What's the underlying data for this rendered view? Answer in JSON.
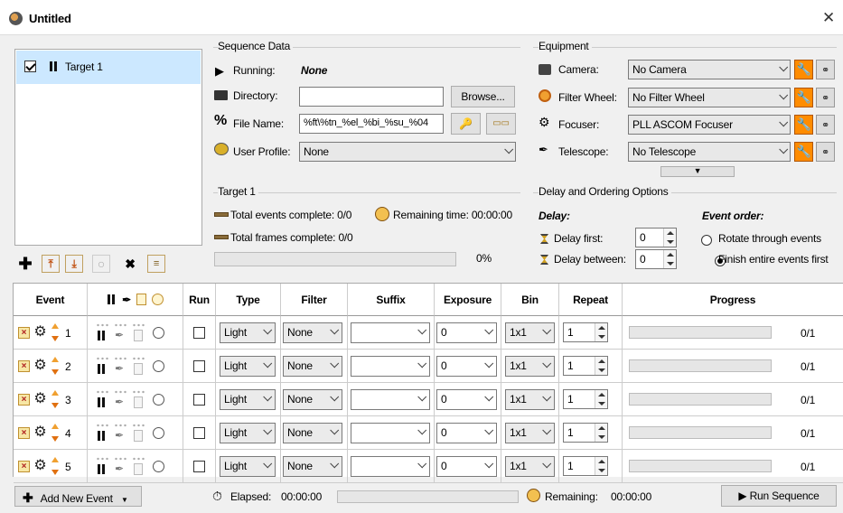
{
  "window": {
    "title": "Untitled",
    "close": "✕"
  },
  "targets": [
    {
      "label": "Target 1",
      "checked": true
    }
  ],
  "sequence_data": {
    "title": "Sequence Data",
    "running_label": "Running:",
    "running_value": "None",
    "directory_label": "Directory:",
    "directory_value": "",
    "browse_label": "Browse...",
    "filename_label": "File Name:",
    "filename_value": "%ft\\%tn_%el_%bi_%su_%04",
    "profile_label": "User Profile:",
    "profile_value": "None"
  },
  "equipment": {
    "title": "Equipment",
    "camera_label": "Camera:",
    "camera_value": "No Camera",
    "filterwheel_label": "Filter Wheel:",
    "filterwheel_value": "No Filter Wheel",
    "focuser_label": "Focuser:",
    "focuser_value": "PLL ASCOM Focuser",
    "telescope_label": "Telescope:",
    "telescope_value": "No Telescope"
  },
  "target_stats": {
    "title": "Target 1",
    "events_label": "Total events complete: 0/0",
    "remaining_label": "Remaining time: 00:00:00",
    "frames_label": "Total frames complete: 0/0",
    "progress_text": "0%",
    "progress_fraction": 0
  },
  "delay": {
    "title": "Delay and Ordering Options",
    "delay_heading": "Delay:",
    "order_heading": "Event order:",
    "delay_first_label": "Delay first:",
    "delay_first_value": "0",
    "delay_between_label": "Delay between:",
    "delay_between_value": "0",
    "rotate_label": "Rotate through events",
    "finish_label": "Finish entire events first",
    "selected": "finish"
  },
  "table": {
    "headers": [
      "Event",
      "Run",
      "Type",
      "Filter",
      "Suffix",
      "Exposure",
      "Bin",
      "Repeat",
      "Progress"
    ],
    "rows": [
      {
        "num": "1",
        "type": "Light",
        "filter": "None",
        "suffix": "",
        "exposure": "0",
        "bin": "1x1",
        "repeat": "1",
        "progress": "0/1"
      },
      {
        "num": "2",
        "type": "Light",
        "filter": "None",
        "suffix": "",
        "exposure": "0",
        "bin": "1x1",
        "repeat": "1",
        "progress": "0/1"
      },
      {
        "num": "3",
        "type": "Light",
        "filter": "None",
        "suffix": "",
        "exposure": "0",
        "bin": "1x1",
        "repeat": "1",
        "progress": "0/1"
      },
      {
        "num": "4",
        "type": "Light",
        "filter": "None",
        "suffix": "",
        "exposure": "0",
        "bin": "1x1",
        "repeat": "1",
        "progress": "0/1"
      },
      {
        "num": "5",
        "type": "Light",
        "filter": "None",
        "suffix": "",
        "exposure": "0",
        "bin": "1x1",
        "repeat": "1",
        "progress": "0/1"
      }
    ]
  },
  "footer": {
    "add_event_label": "Add New Event",
    "elapsed_label": "Elapsed:",
    "elapsed_value": "00:00:00",
    "remaining_label": "Remaining:",
    "remaining_value": "00:00:00",
    "run_label": "Run Sequence"
  },
  "colors": {
    "accent_orange": "#ff8c00",
    "selection": "#cce8ff"
  }
}
